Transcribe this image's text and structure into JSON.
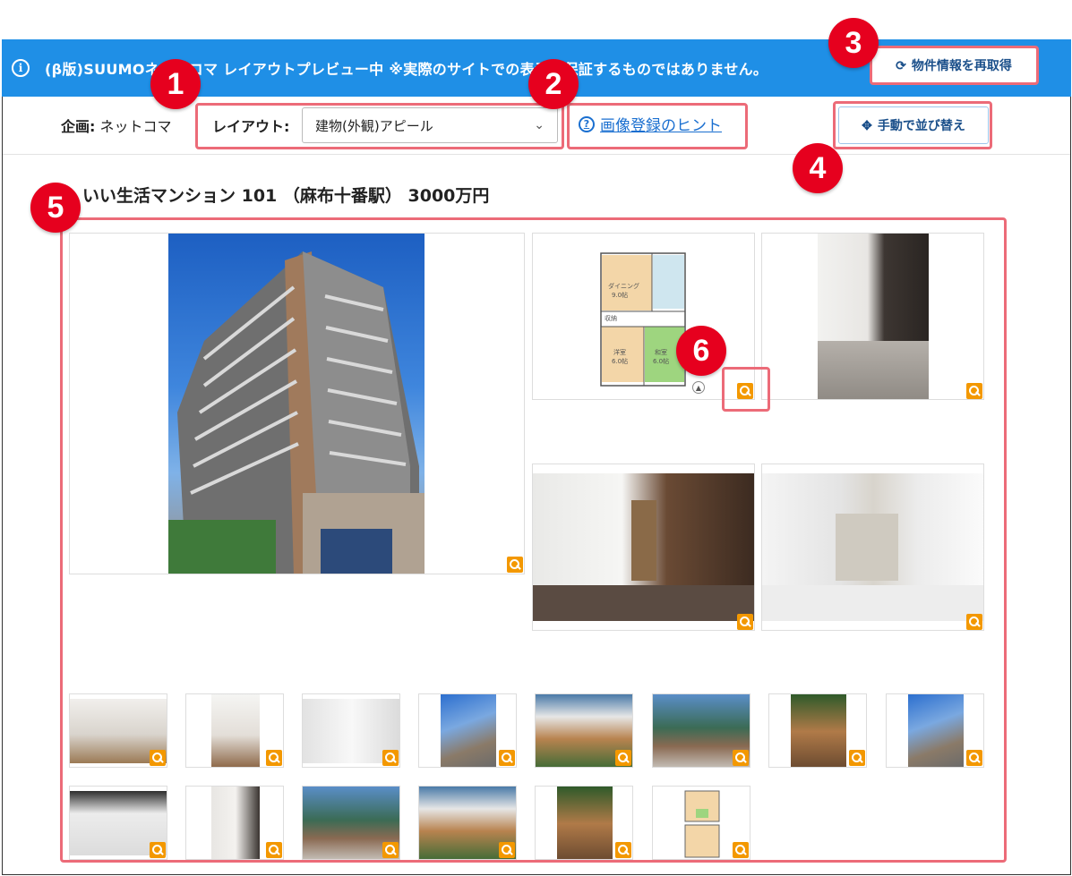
{
  "banner": {
    "notice": "(β版)SUUMOネットコマ レイアウトプレビュー中 ※実際のサイトでの表示を保証するものではありません。",
    "refetch_label": "物件情報を再取得"
  },
  "toolbar": {
    "plan_key": "企画:",
    "plan_value": "ネットコマ",
    "layout_key": "レイアウト:",
    "layout_value": "建物(外観)アピール",
    "hint_label": "画像登録のヒント",
    "sort_label": "手動で並び替え"
  },
  "property": {
    "title": "いい生活マンション 101 （麻布十番駅） 3000万円"
  },
  "floorplan": {
    "dining": "ダイニング",
    "dining_size": "9.0帖",
    "western": "洋室",
    "western_size": "6.0帖",
    "japanese": "和室",
    "japanese_size": "6.0帖",
    "storage": "収納"
  },
  "callouts": [
    "1",
    "2",
    "3",
    "4",
    "5",
    "6"
  ],
  "colors": {
    "banner": "#1f8fe6",
    "callout_badge": "#e6001e",
    "callout_box": "#ec6b78",
    "zoom_icon": "#f39800",
    "link": "#1a6fd0"
  }
}
